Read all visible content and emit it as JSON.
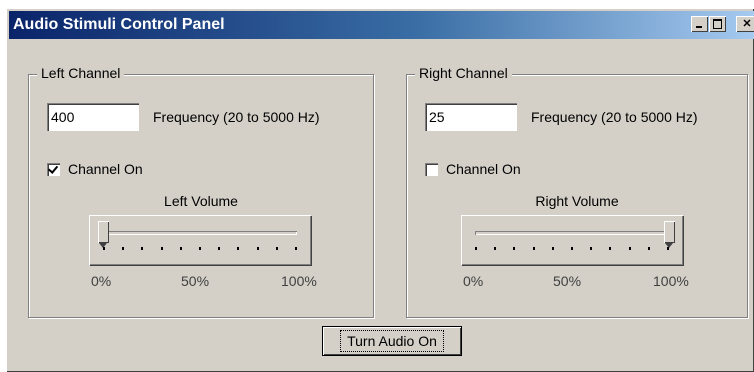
{
  "window": {
    "title": "Audio Stimuli Control Panel"
  },
  "titlebar_buttons": [
    "minimize-icon",
    "maximize-icon",
    "close-icon"
  ],
  "left": {
    "legend": "Left Channel",
    "frequency": "400",
    "frequency_label": "Frequency (20 to 5000 Hz)",
    "channel_on_label": "Channel On",
    "channel_on": true,
    "volume_label": "Left Volume",
    "volume": 0,
    "scale": [
      "0%",
      "50%",
      "100%"
    ]
  },
  "right": {
    "legend": "Right Channel",
    "frequency": "25",
    "frequency_label": "Frequency (20 to 5000 Hz)",
    "channel_on_label": "Channel On",
    "channel_on": false,
    "volume_label": "Right Volume",
    "volume": 1,
    "scale": [
      "0%",
      "50%",
      "100%"
    ]
  },
  "audio_button": "Turn Audio On",
  "colors": {
    "title_start": "#0a246a",
    "title_end": "#a6caf0",
    "face": "#d4d0c8"
  }
}
